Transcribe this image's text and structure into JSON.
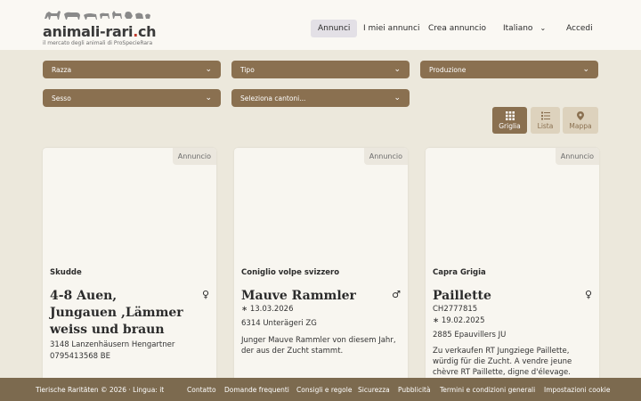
{
  "logo": {
    "name": "animali-rari",
    "dot": ".",
    "tld": "ch",
    "subtitle": "il mercato degli animali di ProSpecieRara"
  },
  "nav": {
    "items": [
      "Annunci",
      "I miei annunci",
      "Crea annuncio"
    ],
    "language": "Italiano",
    "login": "Accedi"
  },
  "filters": {
    "razza": "Razza",
    "tipo": "Tipo",
    "produzione": "Produzione",
    "sesso": "Sesso",
    "cantoni": "Seleziona cantoni..."
  },
  "views": {
    "grid": "Griglia",
    "list": "Lista",
    "map": "Mappa"
  },
  "cards": [
    {
      "badge": "Annuncio",
      "breed": "Skudde",
      "title": "4-8 Auen, Jungauen ,Lämmer weiss und braun",
      "sex": "♀",
      "location": "3148 Lanzenhäusern Hengartner",
      "phone": "0795413568 BE"
    },
    {
      "badge": "Annuncio",
      "breed": "Coniglio volpe svizzero",
      "title": "Mauve Rammler",
      "sex": "♂",
      "birth": "∗ 13.03.2026",
      "location": "6314 Unterägeri ZG",
      "description": "Junger Mauve Rammler von diesem Jahr, der aus der Zucht stammt."
    },
    {
      "badge": "Annuncio",
      "breed": "Capra Grigia",
      "title": "Paillette",
      "sex": "♀",
      "id": "CH2777815",
      "birth": "∗ 19.02.2025",
      "location": "2885 Epauvillers JU",
      "description": "Zu verkaufen RT Jungziege Paillette, würdig für die Zucht. A vendre jeune chèvre RT Paillette, digne d'élevage."
    }
  ],
  "footer": {
    "copyright": "Tierische Raritäten © 2026 · Lingua: it",
    "links": [
      "Contatto",
      "Domande frequenti",
      "Consigli e regole",
      "Sicurezza",
      "Pubblicità",
      "Termini e condizioni generali",
      "Impostazioni cookie"
    ]
  },
  "colors": {
    "accent": "#8a7050",
    "footer": "#7c6a4f",
    "background": "#ece8dc"
  }
}
